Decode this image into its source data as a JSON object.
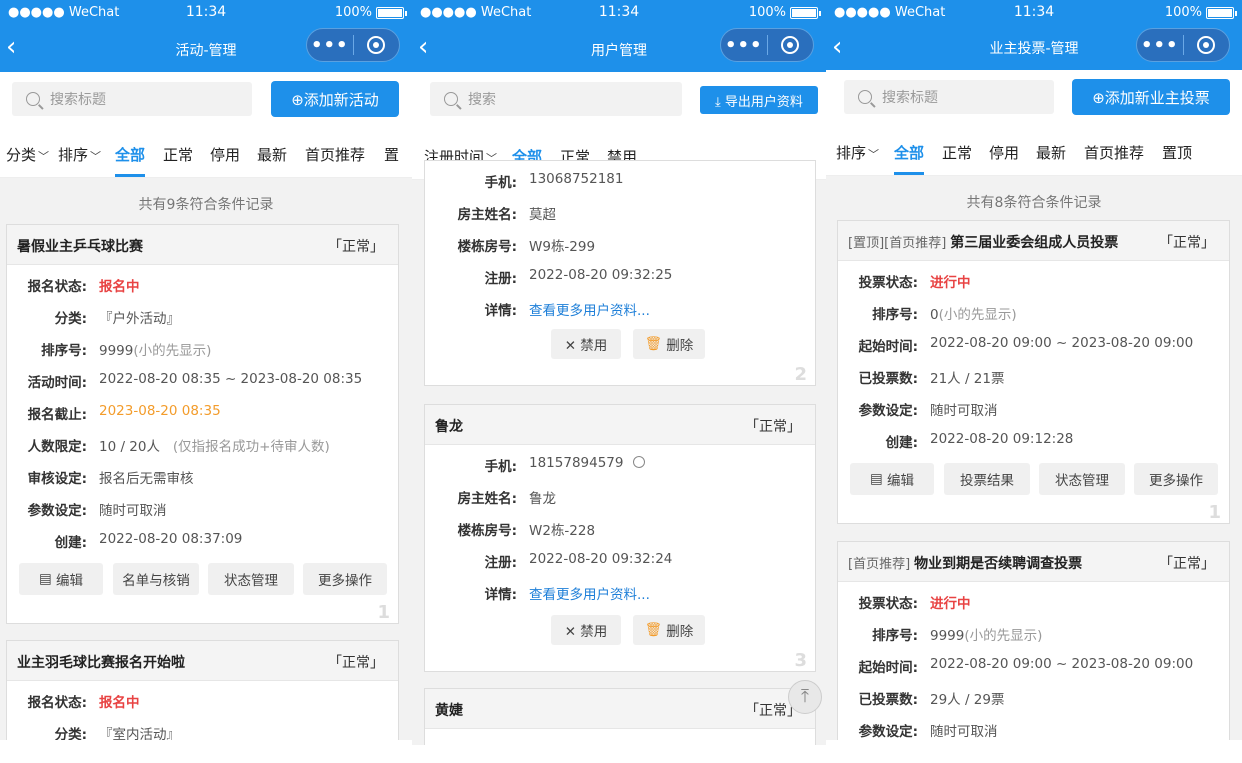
{
  "status": {
    "carrier": "●●●●● WeChat",
    "time": "11:34",
    "battery": "100%"
  },
  "screens": [
    {
      "title": "活动-管理",
      "search_placeholder": "搜索标题",
      "action": "⊕添加新活动",
      "tabs": [
        "分类",
        "排序",
        "全部",
        "正常",
        "停用",
        "最新",
        "首页推荐",
        "置"
      ],
      "count": "共有9条符合条件记录",
      "cards": [
        {
          "name": "暑假业主乒乓球比赛",
          "status": "「正常」",
          "rows": [
            {
              "label": "报名状态:",
              "value": "报名中"
            },
            {
              "label": "分类:",
              "value": "『户外活动』"
            },
            {
              "label": "排序号:",
              "value": "9999",
              "note": "(小的先显示)"
            },
            {
              "label": "活动时间:",
              "value": "2022-08-20 08:35 ~ 2023-08-20 08:35"
            },
            {
              "label": "报名截止:",
              "value": "2023-08-20 08:35"
            },
            {
              "label": "人数限定:",
              "value": "10 / 20人",
              "note": "(仅指报名成功+待审人数)"
            },
            {
              "label": "审核设定:",
              "value": "报名后无需审核"
            },
            {
              "label": "参数设定:",
              "value": "随时可取消"
            },
            {
              "label": "创建:",
              "value": "2022-08-20 08:37:09"
            }
          ],
          "buttons": [
            "编辑",
            "名单与核销",
            "状态管理",
            "更多操作"
          ],
          "index": "1"
        },
        {
          "name": "业主羽毛球比赛报名开始啦",
          "status": "「正常」",
          "rows": [
            {
              "label": "报名状态:",
              "value": "报名中"
            },
            {
              "label": "分类:",
              "value": "『室内活动』"
            }
          ]
        }
      ]
    },
    {
      "title": "用户管理",
      "search_placeholder": "搜索",
      "action": "⤓ 导出用户资料",
      "tabs": [
        "注册时间",
        "全部",
        "正常",
        "禁用"
      ],
      "cards": [
        {
          "rows": [
            {
              "label": "手机:",
              "value": "13068752181"
            },
            {
              "label": "房主姓名:",
              "value": "莫超"
            },
            {
              "label": "楼栋房号:",
              "value": "W9栋-299"
            },
            {
              "label": "注册:",
              "value": "2022-08-20 09:32:25"
            },
            {
              "label": "详情:",
              "value": "查看更多用户资料..."
            }
          ],
          "buttons": [
            "✕ 禁用",
            "删除"
          ],
          "index": "2"
        },
        {
          "name": "鲁龙",
          "status": "「正常」",
          "rows": [
            {
              "label": "手机:",
              "value": "18157894579"
            },
            {
              "label": "房主姓名:",
              "value": "鲁龙"
            },
            {
              "label": "楼栋房号:",
              "value": "W2栋-228"
            },
            {
              "label": "注册:",
              "value": "2022-08-20 09:32:24"
            },
            {
              "label": "详情:",
              "value": "查看更多用户资料..."
            }
          ],
          "buttons": [
            "✕ 禁用",
            "删除"
          ],
          "index": "3"
        },
        {
          "name": "黄婕",
          "status": "「正常」"
        }
      ]
    },
    {
      "title": "业主投票-管理",
      "search_placeholder": "搜索标题",
      "action": "⊕添加新业主投票",
      "tabs": [
        "排序",
        "全部",
        "正常",
        "停用",
        "最新",
        "首页推荐",
        "置顶"
      ],
      "count": "共有8条符合条件记录",
      "cards": [
        {
          "prefix": "[置顶][首页推荐]",
          "name": "第三届业委会组成人员投票",
          "status": "「正常」",
          "rows": [
            {
              "label": "投票状态:",
              "value": "进行中"
            },
            {
              "label": "排序号:",
              "value": "0",
              "note": "(小的先显示)"
            },
            {
              "label": "起始时间:",
              "value": "2022-08-20 09:00 ~ 2023-08-20 09:00"
            },
            {
              "label": "已投票数:",
              "value": "21人 / 21票"
            },
            {
              "label": "参数设定:",
              "value": "随时可取消"
            },
            {
              "label": "创建:",
              "value": "2022-08-20 09:12:28"
            }
          ],
          "buttons": [
            "编辑",
            "投票结果",
            "状态管理",
            "更多操作"
          ],
          "index": "1"
        },
        {
          "prefix": "[首页推荐]",
          "name": "物业到期是否续聘调查投票",
          "status": "「正常」",
          "rows": [
            {
              "label": "投票状态:",
              "value": "进行中"
            },
            {
              "label": "排序号:",
              "value": "9999",
              "note": "(小的先显示)"
            },
            {
              "label": "起始时间:",
              "value": "2022-08-20 09:00 ~ 2023-08-20 09:00"
            },
            {
              "label": "已投票数:",
              "value": "29人 / 29票"
            },
            {
              "label": "参数设定:",
              "value": "随时可取消"
            }
          ]
        }
      ]
    }
  ],
  "icons": {
    "back": "chevron-left-icon",
    "more": "more-dots-icon",
    "close": "target-ring-icon",
    "search": "search-icon",
    "top": "back-to-top-icon"
  },
  "colors": {
    "primary": "#1e90ea",
    "red": "#e84343",
    "orange": "#f39c2b",
    "link": "#1e7fd8"
  }
}
